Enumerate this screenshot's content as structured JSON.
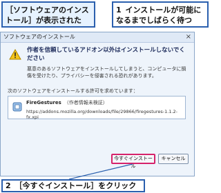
{
  "callouts": {
    "left": "［ソフトウェアのインストール］が表示された",
    "right_num": "1",
    "right": "インストールが可能になるまでしばらく待つ",
    "bottom_num": "2",
    "bottom": "［今すぐインストール］をクリック"
  },
  "dialog": {
    "title": "ソフトウェアのインストール",
    "close": "×",
    "heading": "作者を信頼しているアドオン以外はインストールしないでください",
    "description": "悪意のあるソフトウェアをインストールしてしまうと、コンピュータに損傷を受けたり、プライバシーを侵害される恐れがあります。",
    "request": "次のソフトウェアをインストールする許可を求めています：",
    "addon": {
      "name": "FireGestures",
      "unverified": "（作者情報未検証）",
      "url": "https://addons.mozilla.org/downloads/file/29866/firegestures-1.1.2-fx.xpi"
    },
    "buttons": {
      "install": "今すぐインストール",
      "cancel": "キャンセル"
    }
  },
  "icons": {
    "warning": "warning-icon",
    "addon": "addon-icon"
  },
  "colors": {
    "callout_border": "#2a5fae",
    "highlight": "#d6226a"
  }
}
